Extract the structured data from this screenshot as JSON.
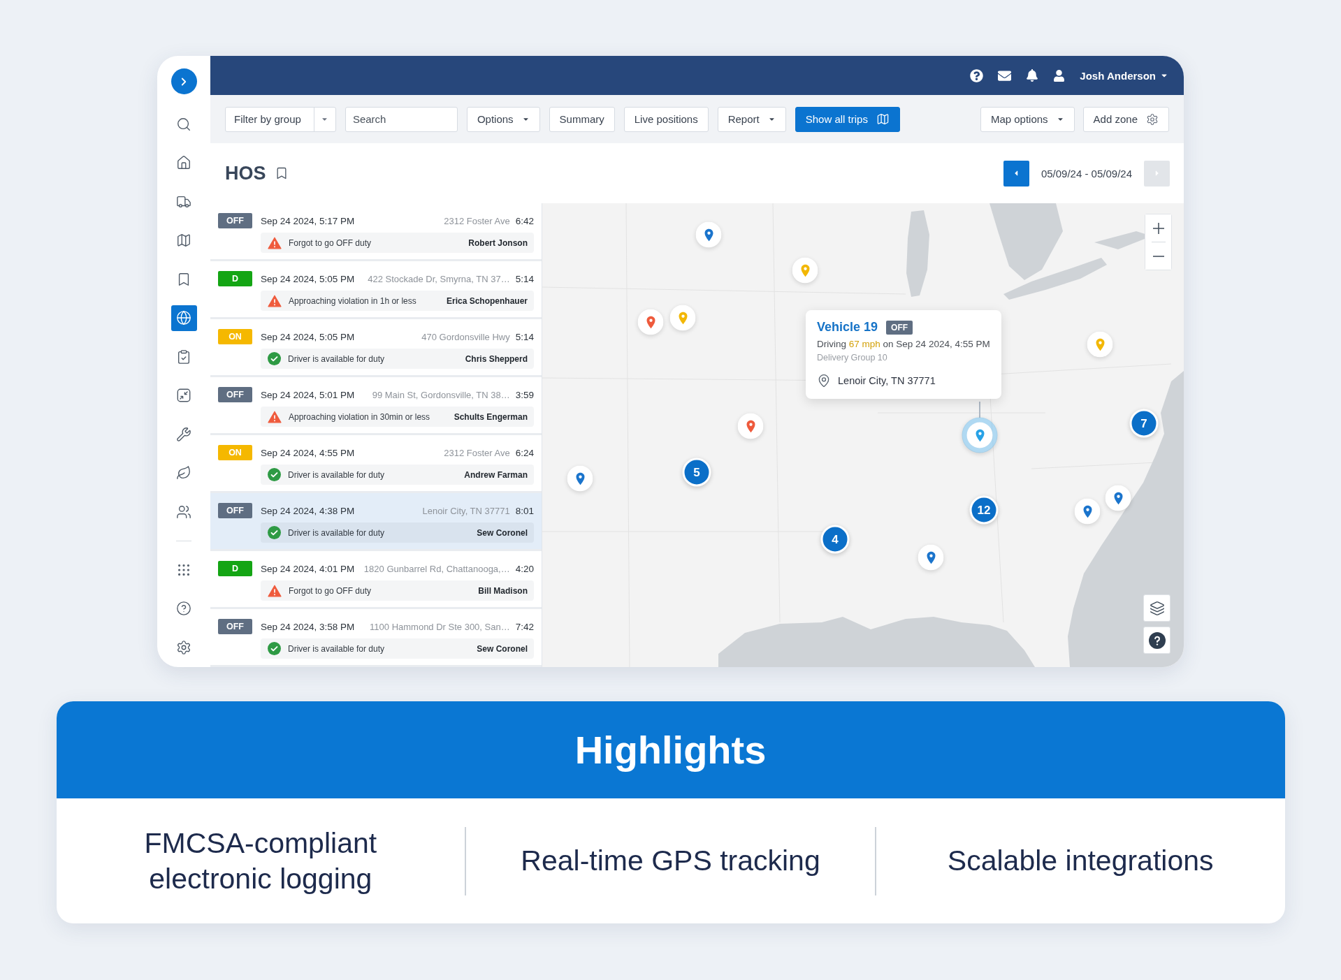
{
  "sidebar": {
    "items": [
      {
        "selected": false
      },
      {
        "selected": false
      },
      {
        "selected": false
      },
      {
        "selected": false
      },
      {
        "selected": false
      },
      {
        "selected": true
      },
      {
        "selected": false
      },
      {
        "selected": false
      },
      {
        "selected": false
      },
      {
        "selected": false
      },
      {
        "selected": false
      }
    ],
    "bottom_items": [
      {
        "selected": false
      },
      {
        "selected": false
      },
      {
        "selected": false
      }
    ]
  },
  "top_bar": {
    "user_name": "Josh Anderson"
  },
  "toolbar": {
    "left": [
      {
        "kind": "split-select",
        "label": "Filter by group"
      },
      {
        "kind": "search",
        "placeholder": "Search"
      },
      {
        "kind": "dropdown",
        "label": "Options"
      },
      {
        "kind": "button",
        "label": "Summary"
      },
      {
        "kind": "button",
        "label": "Live positions"
      },
      {
        "kind": "dropdown",
        "label": "Report"
      },
      {
        "kind": "primary",
        "label": "Show all trips"
      }
    ],
    "right": [
      {
        "kind": "dropdown",
        "label": "Map options"
      },
      {
        "kind": "settings",
        "label": "Add zone"
      }
    ]
  },
  "header": {
    "title": "HOS",
    "date_range": "05/09/24 - 05/09/24",
    "prev": {
      "disabled": false
    },
    "next": {
      "disabled": true
    }
  },
  "events": [
    {
      "status": {
        "label": "OFF",
        "color": "#5f6e82"
      },
      "time": "Sep 24 2024, 5:17 PM",
      "address": "2312 Foster Ave",
      "duration": "6:42",
      "kind": "warning",
      "message": "Forgot to go OFF duty",
      "driver": "Robert Jonson",
      "selected": false
    },
    {
      "status": {
        "label": "D",
        "color": "#14a514"
      },
      "time": "Sep 24 2024, 5:05 PM",
      "address": "422 Stockade Dr, Smyrna, TN 37…",
      "duration": "5:14",
      "kind": "warning",
      "message": "Approaching violation in 1h or less",
      "driver": "Erica Schopenhauer",
      "selected": false
    },
    {
      "status": {
        "label": "ON",
        "color": "#f5b800"
      },
      "time": "Sep 24 2024, 5:05 PM",
      "address": "470 Gordonsville Hwy",
      "duration": "5:14",
      "kind": "ok",
      "message": "Driver is available for duty",
      "driver": "Chris Shepperd",
      "selected": false
    },
    {
      "status": {
        "label": "OFF",
        "color": "#5f6e82"
      },
      "time": "Sep 24 2024, 5:01 PM",
      "address": "99 Main St, Gordonsville, TN 38…",
      "duration": "3:59",
      "kind": "warning",
      "message": "Approaching violation in 30min or less",
      "driver": "Schults Engerman",
      "selected": false
    },
    {
      "status": {
        "label": "ON",
        "color": "#f5b800"
      },
      "time": "Sep 24 2024, 4:55 PM",
      "address": "2312 Foster Ave",
      "duration": "6:24",
      "kind": "ok",
      "message": "Driver is available for duty",
      "driver": "Andrew Farman",
      "selected": false
    },
    {
      "status": {
        "label": "OFF",
        "color": "#5f6e82"
      },
      "time": "Sep 24 2024, 4:38 PM",
      "address": "Lenoir City, TN 37771",
      "duration": "8:01",
      "kind": "ok",
      "message": "Driver is available for duty",
      "driver": "Sew Coronel",
      "selected": true
    },
    {
      "status": {
        "label": "D",
        "color": "#14a514"
      },
      "time": "Sep 24 2024, 4:01 PM",
      "address": "1820 Gunbarrel Rd, Chattanooga,…",
      "duration": "4:20",
      "kind": "warning",
      "message": "Forgot to go OFF duty",
      "driver": "Bill Madison",
      "selected": false
    },
    {
      "status": {
        "label": "OFF",
        "color": "#5f6e82"
      },
      "time": "Sep 24 2024, 3:58 PM",
      "address": "1100 Hammond Dr Ste 300, San…",
      "duration": "7:42",
      "kind": "ok",
      "message": "Driver is available for duty",
      "driver": "Sew Coronel",
      "selected": false
    }
  ],
  "map": {
    "markers": [
      {
        "kind": "pin",
        "color": "#1a74cc",
        "selected": false
      },
      {
        "kind": "pin",
        "color": "#f2b705",
        "selected": false
      },
      {
        "kind": "pin",
        "color": "#ee5a3c",
        "selected": false
      },
      {
        "kind": "pin",
        "color": "#f2b705",
        "selected": false
      },
      {
        "kind": "pin",
        "color": "#f2b705",
        "selected": false
      },
      {
        "kind": "pin",
        "color": "#ee5a3c",
        "selected": false
      },
      {
        "kind": "cluster",
        "count": "7"
      },
      {
        "kind": "pin",
        "color": "#28a2e6",
        "selected": true
      },
      {
        "kind": "cluster",
        "count": "5"
      },
      {
        "kind": "pin",
        "color": "#1a74cc",
        "selected": false
      },
      {
        "kind": "pin",
        "color": "#1a74cc",
        "selected": false
      },
      {
        "kind": "cluster",
        "count": "12"
      },
      {
        "kind": "pin",
        "color": "#1a74cc",
        "selected": false
      },
      {
        "kind": "cluster",
        "count": "4"
      },
      {
        "kind": "pin",
        "color": "#1a74cc",
        "selected": false
      }
    ],
    "popup": {
      "title": "Vehicle 19",
      "status": "OFF",
      "trip_prefix": "Driving",
      "speed": "67 mph",
      "trip_suffix": "on Sep 24 2024, 4:55 PM",
      "group": "Delivery Group 10",
      "location": "Lenoir City, TN 37771"
    }
  },
  "highlights": {
    "title": "Highlights",
    "items": [
      "FMCSA-compliant electronic logging",
      "Real-time GPS tracking",
      "Scalable integrations"
    ]
  }
}
